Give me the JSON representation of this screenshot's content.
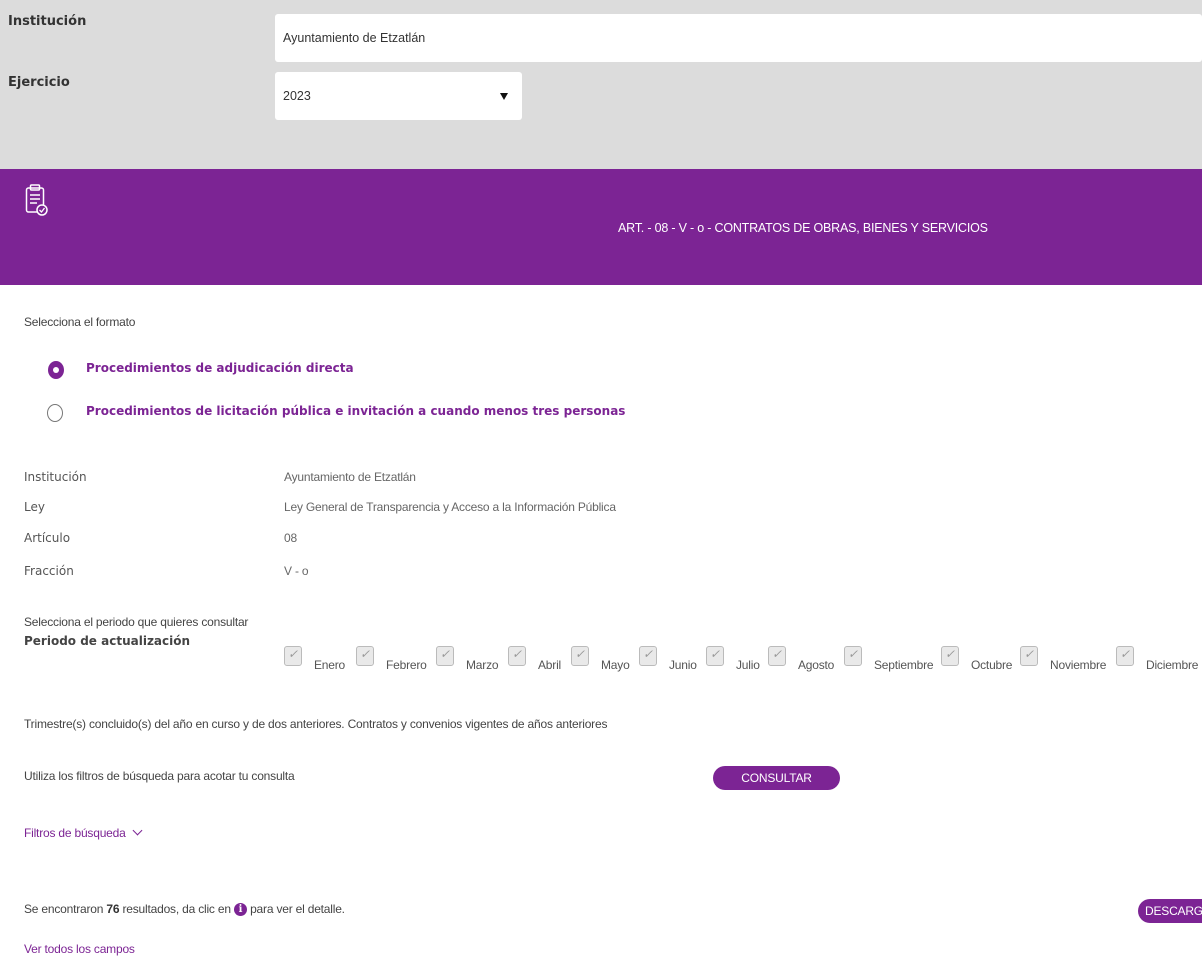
{
  "filters": {
    "institucion_label": "Institución",
    "institucion_value": "Ayuntamiento de Etzatlán",
    "ejercicio_label": "Ejercicio",
    "ejercicio_value": "2023"
  },
  "banner": {
    "icon": "clipboard-document-icon",
    "title": "ART. - 08 - V - o - CONTRATOS DE OBRAS, BIENES Y SERVICIOS",
    "color": "#7c2494"
  },
  "formato": {
    "prompt": "Selecciona el formato",
    "options": [
      {
        "label": "Procedimientos de adjudicación directa",
        "selected": true
      },
      {
        "label": "Procedimientos de licitación pública e invitación a cuando menos tres personas",
        "selected": false
      }
    ]
  },
  "meta": {
    "institucion": {
      "key": "Institución",
      "value": "Ayuntamiento de Etzatlán"
    },
    "ley": {
      "key": "Ley",
      "value": "Ley General de Transparencia y Acceso a la Información Pública"
    },
    "articulo": {
      "key": "Artículo",
      "value": "08"
    },
    "fraccion": {
      "key": "Fracción",
      "value": "V - o"
    }
  },
  "periodo": {
    "prompt": "Selecciona el periodo que quieres consultar",
    "label": "Periodo de actualización",
    "months": [
      "Enero",
      "Febrero",
      "Marzo",
      "Abril",
      "Mayo",
      "Junio",
      "Julio",
      "Agosto",
      "Septiembre",
      "Octubre",
      "Noviembre",
      "Diciembre"
    ],
    "note": "Trimestre(s) concluido(s) del año en curso y de dos anteriores. Contratos y convenios vigentes de años anteriores"
  },
  "search": {
    "hint": "Utiliza los filtros de búsqueda para acotar tu consulta",
    "consultar": "CONSULTAR",
    "filtros": "Filtros de búsqueda"
  },
  "results": {
    "prefix": "Se encontraron ",
    "count": "76",
    "middle": " resultados, da clic en ",
    "suffix": " para ver el detalle.",
    "download": "DESCARGAR",
    "ver_todos": "Ver todos los campos"
  }
}
